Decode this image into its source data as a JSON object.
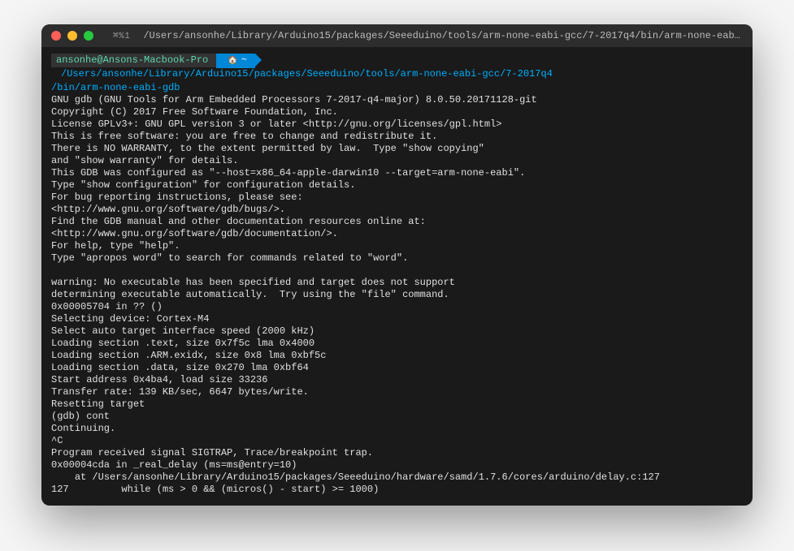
{
  "window": {
    "shortcut": "⌘%1",
    "title": "/Users/ansonhe/Library/Arduino15/packages/Seeeduino/tools/arm-none-eabi-gcc/7-2017q4/bin/arm-none-eabi-gdb (arm..."
  },
  "prompt": {
    "user": "ansonhe@Ansons-Macbook-Pro",
    "badge_icon": "🏠",
    "badge_symbol": "~",
    "path_line1": "/Users/ansonhe/Library/Arduino15/packages/Seeeduino/tools/arm-none-eabi-gcc/7-2017q4",
    "path_line2": "/bin/arm-none-eabi-gdb"
  },
  "output": [
    "GNU gdb (GNU Tools for Arm Embedded Processors 7-2017-q4-major) 8.0.50.20171128-git",
    "Copyright (C) 2017 Free Software Foundation, Inc.",
    "License GPLv3+: GNU GPL version 3 or later <http://gnu.org/licenses/gpl.html>",
    "This is free software: you are free to change and redistribute it.",
    "There is NO WARRANTY, to the extent permitted by law.  Type \"show copying\"",
    "and \"show warranty\" for details.",
    "This GDB was configured as \"--host=x86_64-apple-darwin10 --target=arm-none-eabi\".",
    "Type \"show configuration\" for configuration details.",
    "For bug reporting instructions, please see:",
    "<http://www.gnu.org/software/gdb/bugs/>.",
    "Find the GDB manual and other documentation resources online at:",
    "<http://www.gnu.org/software/gdb/documentation/>.",
    "For help, type \"help\".",
    "Type \"apropos word\" to search for commands related to \"word\".",
    "",
    "warning: No executable has been specified and target does not support",
    "determining executable automatically.  Try using the \"file\" command.",
    "0x00005704 in ?? ()",
    "Selecting device: Cortex-M4",
    "Select auto target interface speed (2000 kHz)",
    "Loading section .text, size 0x7f5c lma 0x4000",
    "Loading section .ARM.exidx, size 0x8 lma 0xbf5c",
    "Loading section .data, size 0x270 lma 0xbf64",
    "Start address 0x4ba4, load size 33236",
    "Transfer rate: 139 KB/sec, 6647 bytes/write.",
    "Resetting target",
    "(gdb) cont",
    "Continuing.",
    "^C",
    "Program received signal SIGTRAP, Trace/breakpoint trap.",
    "0x00004cda in _real_delay (ms=ms@entry=10)",
    "    at /Users/ansonhe/Library/Arduino15/packages/Seeeduino/hardware/samd/1.7.6/cores/arduino/delay.c:127",
    "127         while (ms > 0 && (micros() - start) >= 1000)"
  ]
}
